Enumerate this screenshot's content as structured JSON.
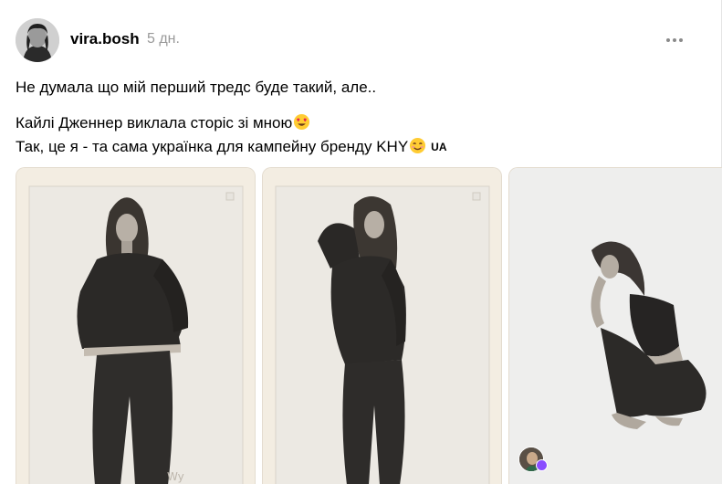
{
  "post": {
    "username": "vira.bosh",
    "time": "5 дн.",
    "lines": [
      "Не думала що мій перший тредс буде такий, але..",
      "Кайлі Дженнер виклала сторіс зі мною",
      "Так, це я - та сама українка для кампейну бренду KHY"
    ],
    "line2_emoji": "smiling-face-with-heart-eyes-icon",
    "line3_emoji": "smiling-face-icon",
    "flag": "UA"
  },
  "photos": [
    {
      "subject": "model-in-hoodie-hands-in-pockets"
    },
    {
      "subject": "model-in-hooded-jacket-side-profile"
    },
    {
      "subject": "model-crouching-barefoot"
    }
  ],
  "colors": {
    "text": "#000000",
    "muted": "#999999",
    "photo_bg": "#f3ede2",
    "badge": "#8a4dff"
  }
}
